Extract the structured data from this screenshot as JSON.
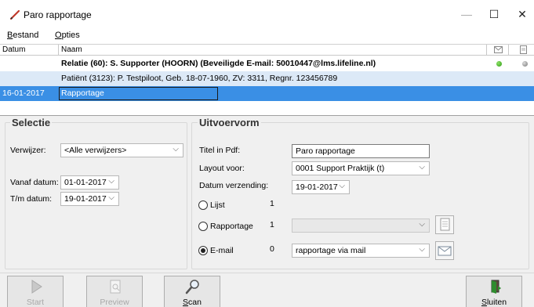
{
  "window": {
    "title": "Paro rapportage"
  },
  "menu": {
    "items": [
      "Bestand",
      "Opties"
    ]
  },
  "grid": {
    "headers": {
      "date": "Datum",
      "name": "Naam"
    },
    "rows": [
      {
        "date": "",
        "name": "Relatie (60): S. Supporter (HOORN)  (Beveiligde E-mail: 50010447@lms.lifeline.nl)",
        "status1": "green",
        "status2": "gray"
      },
      {
        "date": "",
        "name": "Patiënt (3123): P. Testpiloot, Geb. 18-07-1960, ZV: 3311,  Regnr. 123456789"
      },
      {
        "date": "16-01-2017",
        "name": "Rapportage"
      }
    ]
  },
  "selectie": {
    "title": "Selectie",
    "verwijzer_label": "Verwijzer:",
    "verwijzer_value": "<Alle verwijzers>",
    "vanaf_label": "Vanaf datum:",
    "vanaf_value": "01-01-2017",
    "tm_label": "T/m datum:",
    "tm_value": "19-01-2017"
  },
  "uitvoer": {
    "title": "Uitvoervorm",
    "titel_label": "Titel in Pdf:",
    "titel_value": "Paro rapportage",
    "layout_label": "Layout voor:",
    "layout_value": "0001 Support Praktijk (t)",
    "datum_label": "Datum verzending:",
    "datum_value": "19-01-2017",
    "options": [
      {
        "label": "Lijst",
        "count": "1",
        "selected": false
      },
      {
        "label": "Rapportage",
        "count": "1",
        "selected": false,
        "combo": ""
      },
      {
        "label": "E-mail",
        "count": "0",
        "selected": true,
        "combo": "rapportage via mail"
      }
    ]
  },
  "toolbar": {
    "start": "Start",
    "preview": "Preview",
    "scan": "Scan",
    "sluiten": "Sluiten"
  }
}
